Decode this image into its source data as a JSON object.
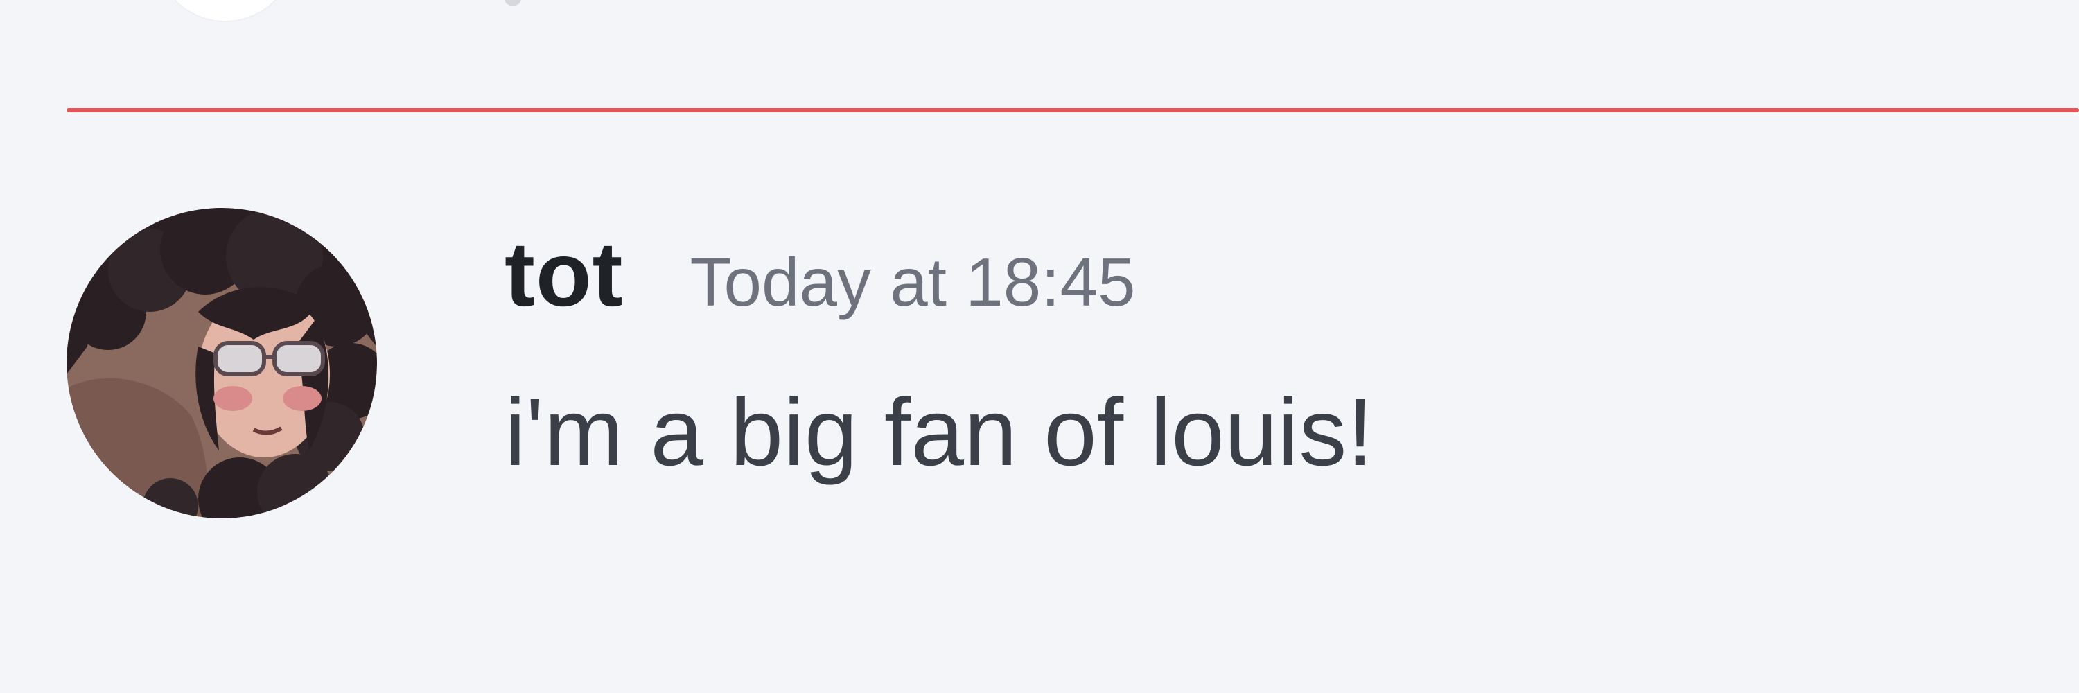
{
  "message": {
    "author": "tot",
    "timestamp": "Today at 18:45",
    "content": "i'm a big fan of louis!"
  },
  "colors": {
    "background": "#f4f5f9",
    "new_messages_divider": "#e0585d",
    "username": "#1f2328",
    "timestamp": "#6d727c",
    "content": "#3b3f48"
  },
  "icons": {
    "avatar": "user-avatar"
  }
}
